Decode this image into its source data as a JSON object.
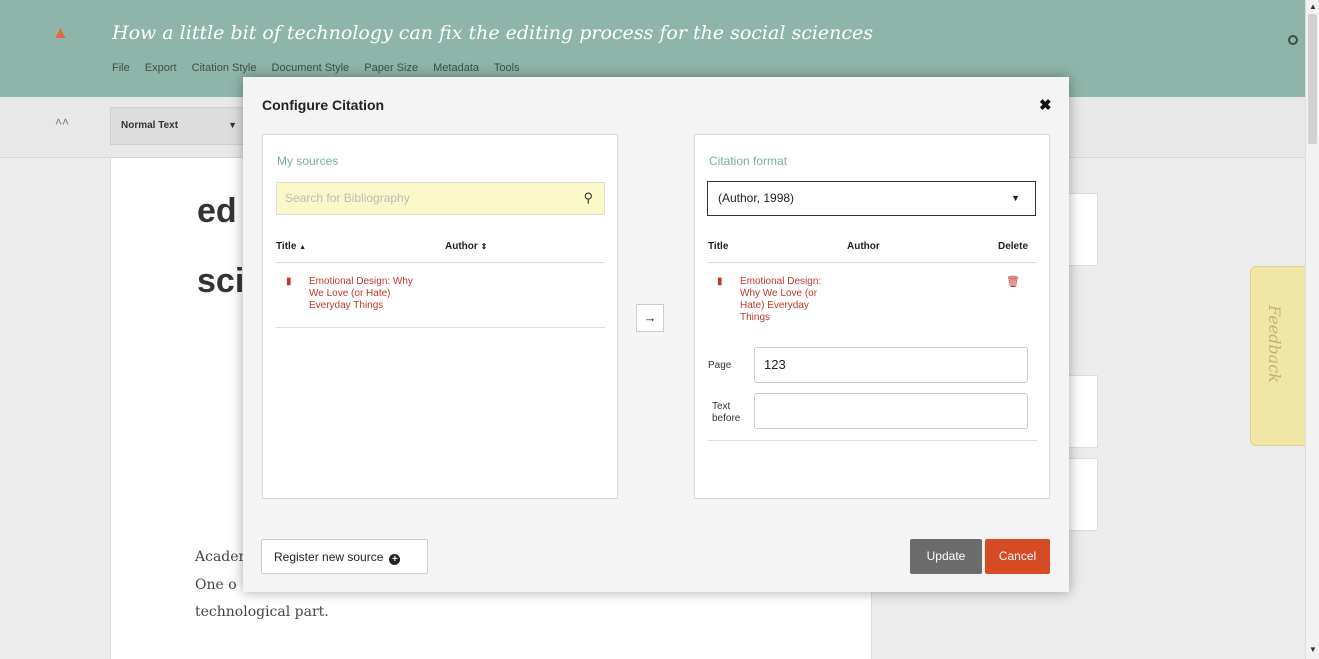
{
  "app": {
    "document_title": "How a little bit of technology can fix the editing process for the social sciences",
    "menu": [
      "File",
      "Export",
      "Citation Style",
      "Document Style",
      "Paper Size",
      "Metadata",
      "Tools"
    ],
    "toolbar": {
      "collapse_icon": "chevrons-up-icon",
      "style_select": "Normal Text"
    },
    "feedback_label": "Feedback"
  },
  "background_doc": {
    "heading_line1": "ed",
    "heading_line2": "sci",
    "body_lines": [
      "Acader",
      "One o",
      "technological part."
    ]
  },
  "modal": {
    "title": "Configure Citation",
    "close_icon": "close-icon",
    "sources": {
      "heading": "My sources",
      "search_placeholder": "Search for Bibliography",
      "col_title": "Title",
      "col_author": "Author",
      "items": [
        {
          "title_line1": "Emotional Design: Why",
          "title_line2": "We Love (or Hate)",
          "title_line3": "Everyday Things"
        }
      ]
    },
    "transfer_icon": "arrow-right-icon",
    "citation": {
      "heading": "Citation format",
      "format_value": "(Author, 1998)",
      "col_title": "Title",
      "col_author": "Author",
      "col_delete": "Delete",
      "items": [
        {
          "title_line1": "Emotional Design:",
          "title_line2": "Why We Love (or",
          "title_line3": "Hate) Everyday",
          "title_line4": "Things"
        }
      ],
      "page_label": "Page",
      "page_value": "123",
      "text_before_label_line1": "Text",
      "text_before_label_line2": "before",
      "text_before_value": ""
    },
    "buttons": {
      "register": "Register new source",
      "update": "Update",
      "cancel": "Cancel"
    }
  }
}
